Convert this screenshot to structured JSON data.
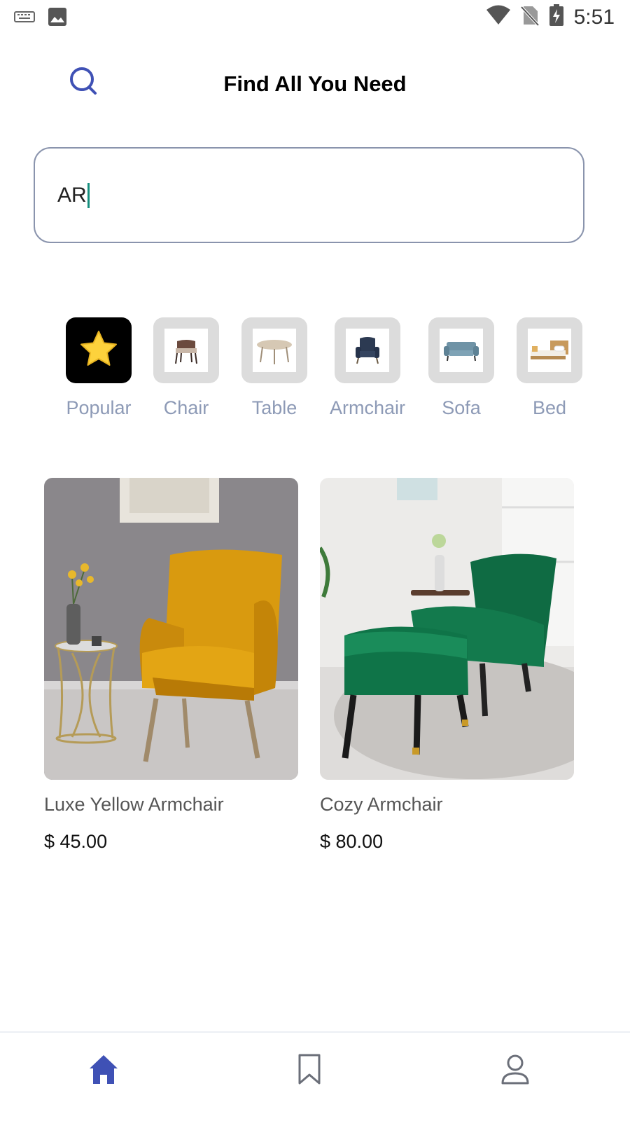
{
  "status_bar": {
    "time": "5:51",
    "icons": [
      "keyboard-icon",
      "image-icon",
      "wifi-icon",
      "no-sim-icon",
      "battery-charging-icon"
    ]
  },
  "header": {
    "title": "Find All You Need",
    "search_icon": "search-icon"
  },
  "search": {
    "value": "AR"
  },
  "categories": [
    {
      "label": "Popular",
      "icon": "star-icon",
      "active": true
    },
    {
      "label": "Chair",
      "icon": "chair-thumbnail",
      "active": false
    },
    {
      "label": "Table",
      "icon": "table-thumbnail",
      "active": false
    },
    {
      "label": "Armchair",
      "icon": "armchair-thumbnail",
      "active": false
    },
    {
      "label": "Sofa",
      "icon": "sofa-thumbnail",
      "active": false
    },
    {
      "label": "Bed",
      "icon": "bed-thumbnail",
      "active": false
    }
  ],
  "products": [
    {
      "name": "Luxe Yellow Armchair",
      "price": "$ 45.00",
      "image": "yellow-armchair-photo"
    },
    {
      "name": "Cozy Armchair",
      "price": "$ 80.00",
      "image": "green-armchair-photo"
    }
  ],
  "bottom_nav": [
    {
      "icon": "home-icon",
      "active": true
    },
    {
      "icon": "bookmark-icon",
      "active": false
    },
    {
      "icon": "profile-icon",
      "active": false
    }
  ],
  "colors": {
    "accent": "#3f51b5",
    "category_label": "#8d9ab6",
    "input_border": "#8a94ad",
    "caret": "#17907f"
  }
}
